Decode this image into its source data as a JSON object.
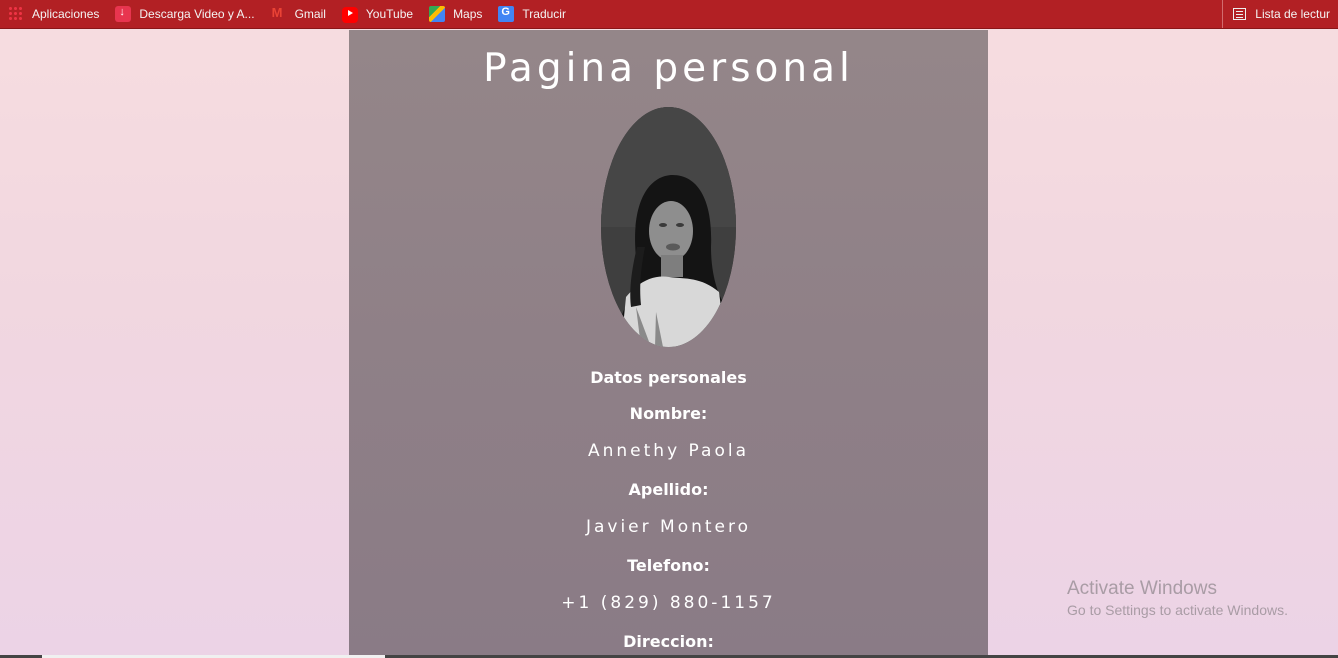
{
  "bookmarks": [
    {
      "label": "Aplicaciones",
      "icon": "apps-icon"
    },
    {
      "label": "Descarga Video y A...",
      "icon": "download-icon"
    },
    {
      "label": "Gmail",
      "icon": "gmail-icon"
    },
    {
      "label": "YouTube",
      "icon": "youtube-icon"
    },
    {
      "label": "Maps",
      "icon": "maps-icon"
    },
    {
      "label": "Traducir",
      "icon": "translate-icon"
    }
  ],
  "reading_list": {
    "label": "Lista de lectur",
    "icon": "reading-list-icon"
  },
  "page": {
    "title": "Pagina personal",
    "section_heading": "Datos personales",
    "fields": [
      {
        "label": "Nombre:",
        "value": "Annethy Paola"
      },
      {
        "label": "Apellido:",
        "value": "Javier Montero"
      },
      {
        "label": "Telefono:",
        "value": "+1 (829) 880-1157"
      },
      {
        "label": "Direccion:",
        "value": ""
      }
    ]
  },
  "watermark": {
    "line1": "Activate Windows",
    "line2": "Go to Settings to activate Windows."
  },
  "colors": {
    "bookmark_bar": "#b22024",
    "card_bg": "#948689",
    "page_bg": "#f7dde0"
  }
}
